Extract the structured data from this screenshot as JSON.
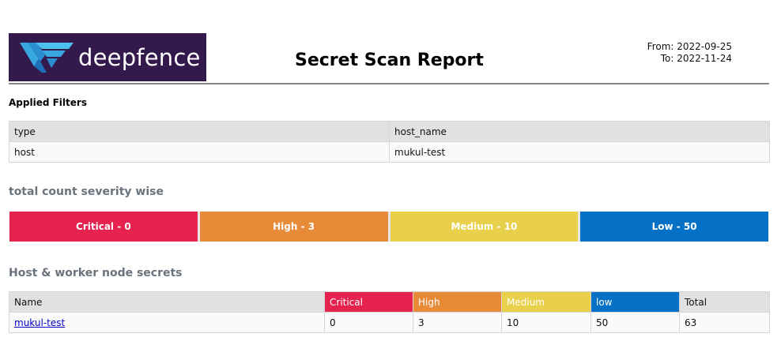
{
  "logo": {
    "text": "deepfence",
    "icon": "deepfence-logo-icon",
    "bg_color": "#34194d"
  },
  "report": {
    "title": "Secret Scan Report",
    "from": "From: 2022-09-25",
    "to": "To: 2022-11-24"
  },
  "filters": {
    "heading": "Applied Filters",
    "headers": [
      "type",
      "host_name"
    ],
    "values": [
      "host",
      "mukul-test"
    ]
  },
  "severity_summary": {
    "heading": "total count severity wise",
    "items": [
      {
        "label": "Critical - 0",
        "color": "#e5234e"
      },
      {
        "label": "High - 3",
        "color": "#e78b39"
      },
      {
        "label": "Medium - 10",
        "color": "#e8d04a"
      },
      {
        "label": "Low - 50",
        "color": "#0571c6"
      }
    ]
  },
  "secrets": {
    "heading": "Host & worker node secrets",
    "headers": {
      "name": "Name",
      "critical": "Critical",
      "high": "High",
      "medium": "Medium",
      "low": "low",
      "total": "Total"
    },
    "rows": [
      {
        "name": "mukul-test",
        "critical": "0",
        "high": "3",
        "medium": "10",
        "low": "50",
        "total": "63"
      }
    ]
  }
}
